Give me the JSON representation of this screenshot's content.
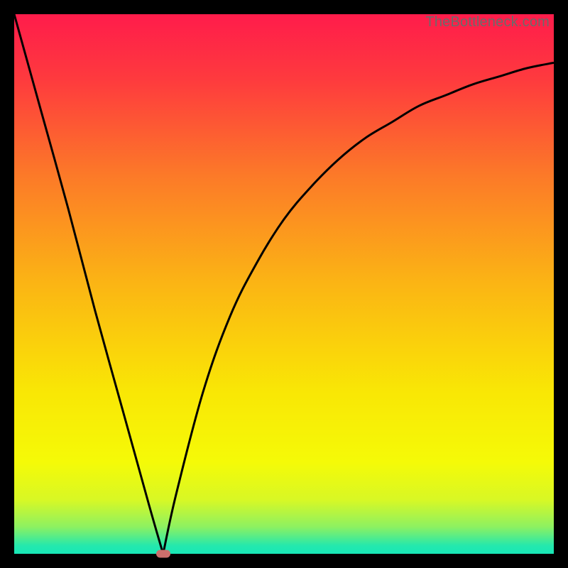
{
  "watermark": "TheBottleneck.com",
  "colors": {
    "background": "#000000",
    "gradient_stops": [
      {
        "pos": 0.0,
        "color": "#FF1C4B"
      },
      {
        "pos": 0.12,
        "color": "#FE3A3E"
      },
      {
        "pos": 0.3,
        "color": "#FC7A28"
      },
      {
        "pos": 0.5,
        "color": "#FBB514"
      },
      {
        "pos": 0.7,
        "color": "#F9E705"
      },
      {
        "pos": 0.83,
        "color": "#F5FA07"
      },
      {
        "pos": 0.9,
        "color": "#D8F825"
      },
      {
        "pos": 0.95,
        "color": "#8DF161"
      },
      {
        "pos": 0.985,
        "color": "#24E8AD"
      },
      {
        "pos": 1.0,
        "color": "#17E7B7"
      }
    ],
    "curve_stroke": "#000000",
    "marker_fill": "#CC6F6C"
  },
  "chart_data": {
    "type": "line",
    "title": "",
    "xlabel": "",
    "ylabel": "",
    "xlim": [
      0,
      100
    ],
    "ylim": [
      0,
      100
    ],
    "series": [
      {
        "name": "left-branch",
        "x": [
          0,
          5,
          10,
          15,
          20,
          25,
          27.6
        ],
        "values": [
          100,
          82,
          64,
          45,
          27,
          9,
          0
        ]
      },
      {
        "name": "right-branch",
        "x": [
          27.6,
          30,
          35,
          40,
          45,
          50,
          55,
          60,
          65,
          70,
          75,
          80,
          85,
          90,
          95,
          100
        ],
        "values": [
          0,
          11,
          30,
          44,
          54,
          62,
          68,
          73,
          77,
          80,
          83,
          85,
          87,
          88.5,
          90,
          91
        ]
      }
    ],
    "marker": {
      "x": 27.6,
      "y": 0
    }
  }
}
